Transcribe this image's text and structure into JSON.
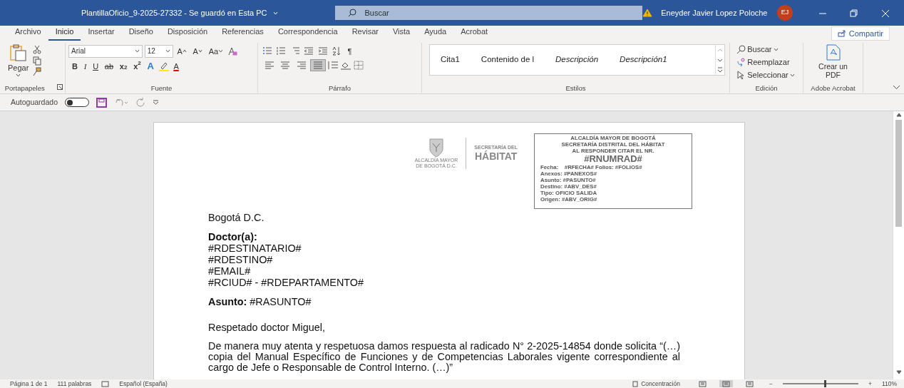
{
  "title_bar": {
    "document_title": "PlantillaOficio_9-2025-27332  -  Se guardó en Esta PC",
    "search_placeholder": "Buscar",
    "user_name": "Eneyder Javier Lopez Poloche",
    "user_initials": "EJ"
  },
  "tabs": [
    {
      "label": "Archivo",
      "selected": false
    },
    {
      "label": "Inicio",
      "selected": true
    },
    {
      "label": "Insertar",
      "selected": false
    },
    {
      "label": "Diseño",
      "selected": false
    },
    {
      "label": "Disposición",
      "selected": false
    },
    {
      "label": "Referencias",
      "selected": false
    },
    {
      "label": "Correspondencia",
      "selected": false
    },
    {
      "label": "Revisar",
      "selected": false
    },
    {
      "label": "Vista",
      "selected": false
    },
    {
      "label": "Ayuda",
      "selected": false
    },
    {
      "label": "Acrobat",
      "selected": false
    }
  ],
  "share_button": "Compartir",
  "clipboard": {
    "paste_label": "Pegar",
    "group_label": "Portapapeles"
  },
  "font": {
    "font_name": "Arial",
    "font_size": "12",
    "size_buttons": [
      "A",
      "A"
    ],
    "case_button": "Aa",
    "format_buttons": [
      {
        "kind": "bold",
        "label": "B"
      },
      {
        "kind": "italic",
        "label": "I"
      },
      {
        "kind": "underline",
        "label": "U"
      },
      {
        "kind": "strike",
        "label": "ab"
      },
      {
        "kind": "sub",
        "label": "x",
        "index": "2"
      },
      {
        "kind": "sup",
        "label": "x",
        "index": "2"
      }
    ],
    "effects_button": "A",
    "font_color_button": "A",
    "group_label": "Fuente"
  },
  "paragraph": {
    "pilcrow": "¶",
    "align_buttons": [
      {
        "selected": false
      },
      {
        "selected": false
      },
      {
        "selected": false
      },
      {
        "selected": true
      }
    ],
    "group_label": "Párrafo"
  },
  "styles": {
    "items": [
      {
        "label": "Cita1",
        "italic": false
      },
      {
        "label": "Contenido de l",
        "italic": false
      },
      {
        "label": "Descripción",
        "italic": true
      },
      {
        "label": "Descripción1",
        "italic": true
      }
    ],
    "group_label": "Estilos"
  },
  "editing": {
    "items": [
      {
        "kind": "find",
        "label": "Buscar"
      },
      {
        "kind": "replace",
        "label": "Reemplazar"
      },
      {
        "kind": "select",
        "label": "Seleccionar"
      }
    ],
    "group_label": "Edición"
  },
  "acrobat": {
    "button": "Crear un PDF",
    "group_label": "Adobe Acrobat"
  },
  "quick_access": {
    "autosave_label": "Autoguardado",
    "autosave_on": false
  },
  "letterhead": {
    "logo_caption": [
      "ALCALDÍA MAYOR",
      "DE BOGOTÁ D.C."
    ],
    "office": [
      "SECRETARÍA DEL",
      "HÁBITAT"
    ],
    "stamp": [
      {
        "kind": "head",
        "text": "ALCALDÍA MAYOR DE BOGOTÁ"
      },
      {
        "kind": "head",
        "text": "SECRETARÍA DISTRITAL DEL HÁBITAT"
      },
      {
        "kind": "head",
        "text": "AL RESPONDER CITAR EL NR."
      },
      {
        "kind": "number",
        "text": "#RNUMRAD#"
      },
      {
        "kind": "field",
        "text": "Fecha:    #RFECHA# Folios: #FOLIOS#"
      },
      {
        "kind": "field",
        "text": "Anexos: #PANEXOS#"
      },
      {
        "kind": "field",
        "text": "Asunto: #PASUNTO#"
      },
      {
        "kind": "field",
        "text": "Destino: #ABV_DES#"
      },
      {
        "kind": "field",
        "text": "Tipo: OFICIO SALIDA"
      },
      {
        "kind": "field",
        "text": "Origen: #ABV_ORIG#"
      }
    ]
  },
  "body": [
    {
      "kind": "block",
      "lines": [
        "Bogotá D.C."
      ]
    },
    {
      "kind": "block",
      "lines": [
        "**Doctor(a):**",
        "#RDESTINATARIO#",
        "#RDESTINO#",
        "#EMAIL#",
        "#RCIUD# - #RDEPARTAMENTO#"
      ]
    },
    {
      "kind": "block",
      "lines": [
        "**Asunto:** #RASUNTO#"
      ]
    },
    {
      "kind": "block",
      "lines": [
        "Respetado doctor Miguel,"
      ]
    },
    {
      "kind": "justified",
      "lines": [
        "De manera muy atenta y respetuosa damos respuesta al radicado N° 2-2025-14854 donde solicita “(…) copia del Manual Específico de Funciones y de Competencias Laborales vigente correspondiente al cargo de Jefe o Responsable de Control Interno. (…)”"
      ]
    }
  ],
  "status_bar": {
    "page": "Página 1 de 1",
    "words": "111 palabras",
    "language": "Español (España)",
    "focus": "Concentración",
    "views": [
      {
        "selected": false
      },
      {
        "selected": true
      },
      {
        "selected": false
      }
    ],
    "zoom_minus": "−",
    "zoom_plus": "+",
    "level": 0.55,
    "zoom": "110%"
  }
}
